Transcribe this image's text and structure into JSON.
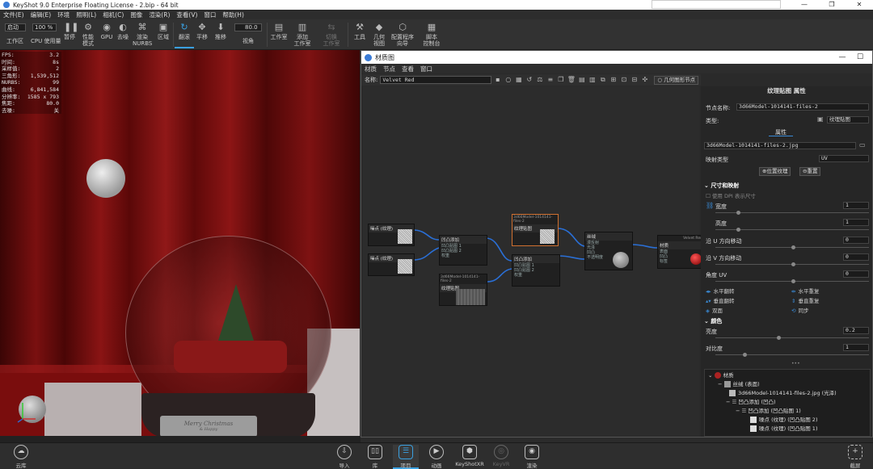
{
  "window": {
    "title": "KeyShot 9.0 Enterprise Floating License  - 2.bip  - 64 bit",
    "controls": [
      "—",
      "❐",
      "✕"
    ]
  },
  "menubar": [
    "文件(E)",
    "编辑(E)",
    "环境",
    "照明(L)",
    "相机(C)",
    "图像",
    "渲染(R)",
    "查看(V)",
    "窗口",
    "帮助(H)"
  ],
  "toolbar": {
    "workspace_label": "工作区",
    "workspace_value": "启动",
    "cpu_label": "CPU 使用量",
    "cpu_value": "100 %",
    "pause": "暂停",
    "perf_mode": "性能\n模式",
    "gpu": "GPU",
    "denoise": "去噪",
    "render_nurbs": "渲染\nNURBS",
    "region": "区域",
    "tumble": "翻滚",
    "pan": "平移",
    "dolly": "推移",
    "fov_value": "80.0",
    "fov_label": "视角",
    "studio": "工作室",
    "add_studio": "添加\n工作室",
    "switch_studio": "切换\n工作室",
    "tools": "工具",
    "geometry_view": "几何\n视图",
    "config_wizard": "配置程序\n向导",
    "script_console": "脚本\n控制台"
  },
  "stats": [
    {
      "label": "FPS:",
      "value": "3.2"
    },
    {
      "label": "时间:",
      "value": "8s"
    },
    {
      "label": "采样值:",
      "value": "2"
    },
    {
      "label": "三角形:",
      "value": "1,539,512"
    },
    {
      "label": "NURBS:",
      "value": "99"
    },
    {
      "label": "曲线:",
      "value": "6,841,584"
    },
    {
      "label": "分辨率:",
      "value": "1585 x 793"
    },
    {
      "label": "焦距:",
      "value": "80.0"
    },
    {
      "label": "去噪:",
      "value": "关"
    }
  ],
  "material_window": {
    "title": "材质图",
    "controls": [
      "—",
      "☐"
    ],
    "menu": [
      "材质",
      "节点",
      "查看",
      "窗口"
    ],
    "name_label": "名称:",
    "name_value": "Velvet Red",
    "geometry_node_button": "几何图形节点"
  },
  "graph": {
    "nodes": [
      {
        "title": "噪点 (纹理)"
      },
      {
        "title": "噪点 (纹理)"
      },
      {
        "title": "凹凸添加",
        "ports": [
          "凹凸贴图 1",
          "凹凸贴图 2",
          "权重"
        ]
      },
      {
        "title": "凹凸添加",
        "ports": [
          "凹凸贴图 1",
          "凹凸贴图 2",
          "权重"
        ]
      },
      {
        "title": "纹理贴图",
        "caption": "3d66Model-1014141-files-2"
      },
      {
        "title": "纹理贴图",
        "caption": "3d66Model-1014141-files-2"
      },
      {
        "title": "丝绒",
        "ports": [
          "漫反射",
          "光泽",
          "凹凸",
          "不透明度"
        ]
      },
      {
        "title": "材质",
        "caption": "Velvet Red",
        "ports": [
          "表面",
          "凹凸",
          "标签"
        ]
      }
    ]
  },
  "properties": {
    "title": "纹理贴图 属性",
    "node_name_label": "节点名称:",
    "node_name_value": "3d66Model-1014141-files-2",
    "type_label": "类型:",
    "type_value": "纹理贴图",
    "tab_label": "属性",
    "file_value": "3d66Model-1014141-files-2.jpg",
    "mapping_label": "映射类型",
    "mapping_value": "UV",
    "position_button": "位置纹理",
    "reset_button": "重置",
    "size_section": "尺寸和映射",
    "use_dpi": "使用 DPI 表示尺寸",
    "width_label": "宽度",
    "width_value": "1",
    "height_label": "高度",
    "height_value": "1",
    "u_shift_label": "沿 U 方向移动",
    "u_shift_value": "0",
    "v_shift_label": "沿 V 方向移动",
    "v_shift_value": "0",
    "angle_label": "角度 UV",
    "angle_value": "0",
    "flip_h": "水平翻转",
    "repeat_h": "水平重复",
    "flip_v": "垂直翻转",
    "repeat_v": "垂直重复",
    "two_sided": "双面",
    "sync": "同步",
    "color_section": "颜色",
    "brightness_label": "亮度",
    "brightness_value": "0.2",
    "contrast_label": "对比度",
    "contrast_value": "1"
  },
  "tree": [
    "材质",
    "丝绒 (表面)",
    "3d66Model-1014141-files-2.jpg (光泽)",
    "凹凸添加 (凹凸)",
    "凹凸添加 (凹凸贴图 1)",
    "噪点 (纹理)  (凹凸贴图 2)",
    "噪点 (纹理)  (凹凸贴图 1)"
  ],
  "scene_text": {
    "plaque_line1": "Merry Christmas",
    "plaque_line2": "& Happy"
  },
  "bottombar": {
    "cloud": "云库",
    "import": "导入",
    "library": "库",
    "project": "项目",
    "animation": "动画",
    "keyshotxr": "KeyShotXR",
    "render": "渲染",
    "screenshot": "截屏",
    "hidden": "KeyVR"
  },
  "colors": {
    "accent": "#3aa0e0",
    "selected_node": "#d07030",
    "curtain": "#8a1414"
  }
}
